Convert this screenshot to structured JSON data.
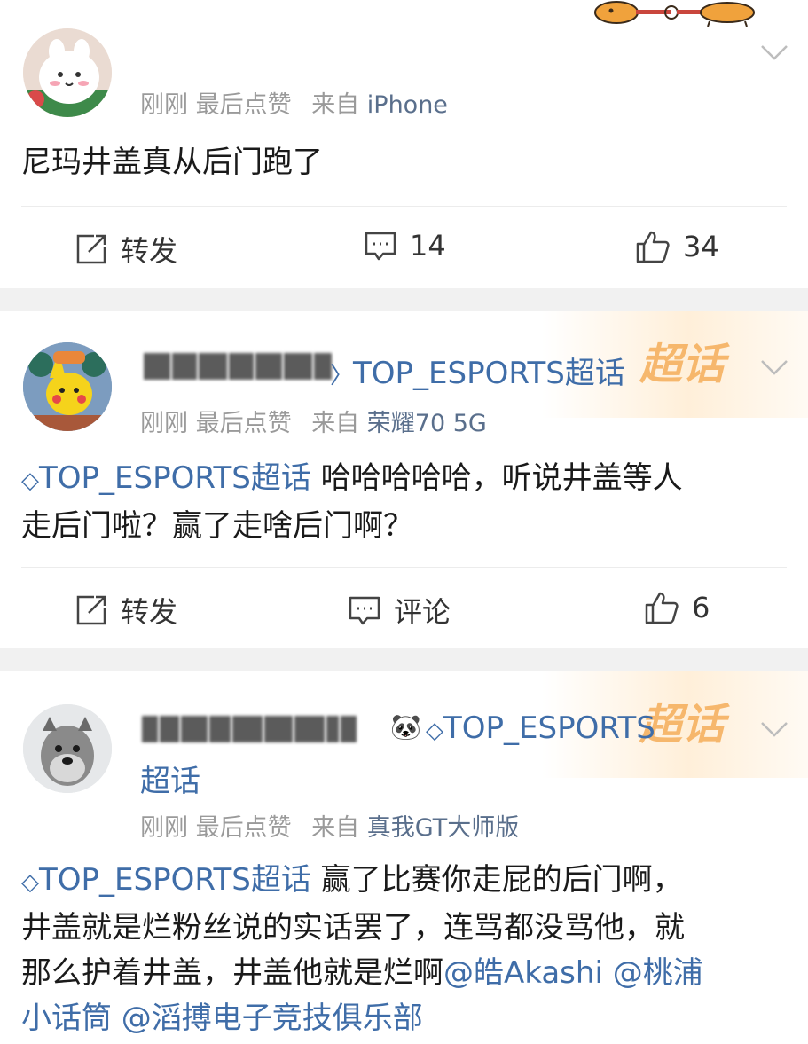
{
  "posts": [
    {
      "meta": {
        "time": "刚刚",
        "liked": "最后点赞",
        "from_label": "来自",
        "device": "iPhone"
      },
      "text": "尼玛井盖真从后门跑了",
      "actions": {
        "repost": "转发",
        "comments": "14",
        "likes": "34"
      }
    },
    {
      "topic": "TOP_ESPORTS超话",
      "meta": {
        "time": "刚刚",
        "liked": "最后点赞",
        "from_label": "来自",
        "device": "荣耀70 5G"
      },
      "body_topic": "TOP_ESPORTS超话",
      "text_line1": " 哈哈哈哈哈，听说井盖等人",
      "text_line2": "走后门啦？赢了走啥后门啊？",
      "actions": {
        "repost": "转发",
        "comments": "评论",
        "likes": "6"
      },
      "badge": "超话"
    },
    {
      "topic": "TOP_ESPORTS",
      "topic_cont": "超话",
      "meta": {
        "time": "刚刚",
        "liked": "最后点赞",
        "from_label": "来自",
        "device": "真我GT大师版"
      },
      "body_topic": "TOP_ESPORTS超话",
      "text_line1": " 赢了比赛你走屁的后门啊，",
      "text_line2": "井盖就是烂粉丝说的实话罢了，连骂都没骂他，就",
      "text_line3a": "那么护着井盖，井盖他就是烂啊",
      "mention1": "@皓Akashi",
      "mention2": " @桃浦",
      "text_line4": "小话筒 @滔搏电子竞技俱乐部",
      "badge": "超话"
    }
  ],
  "colors": {
    "link": "#3f6da8",
    "meta": "#9a9a9a",
    "separator": "#f1f1f1",
    "badge": "#f4a447"
  }
}
